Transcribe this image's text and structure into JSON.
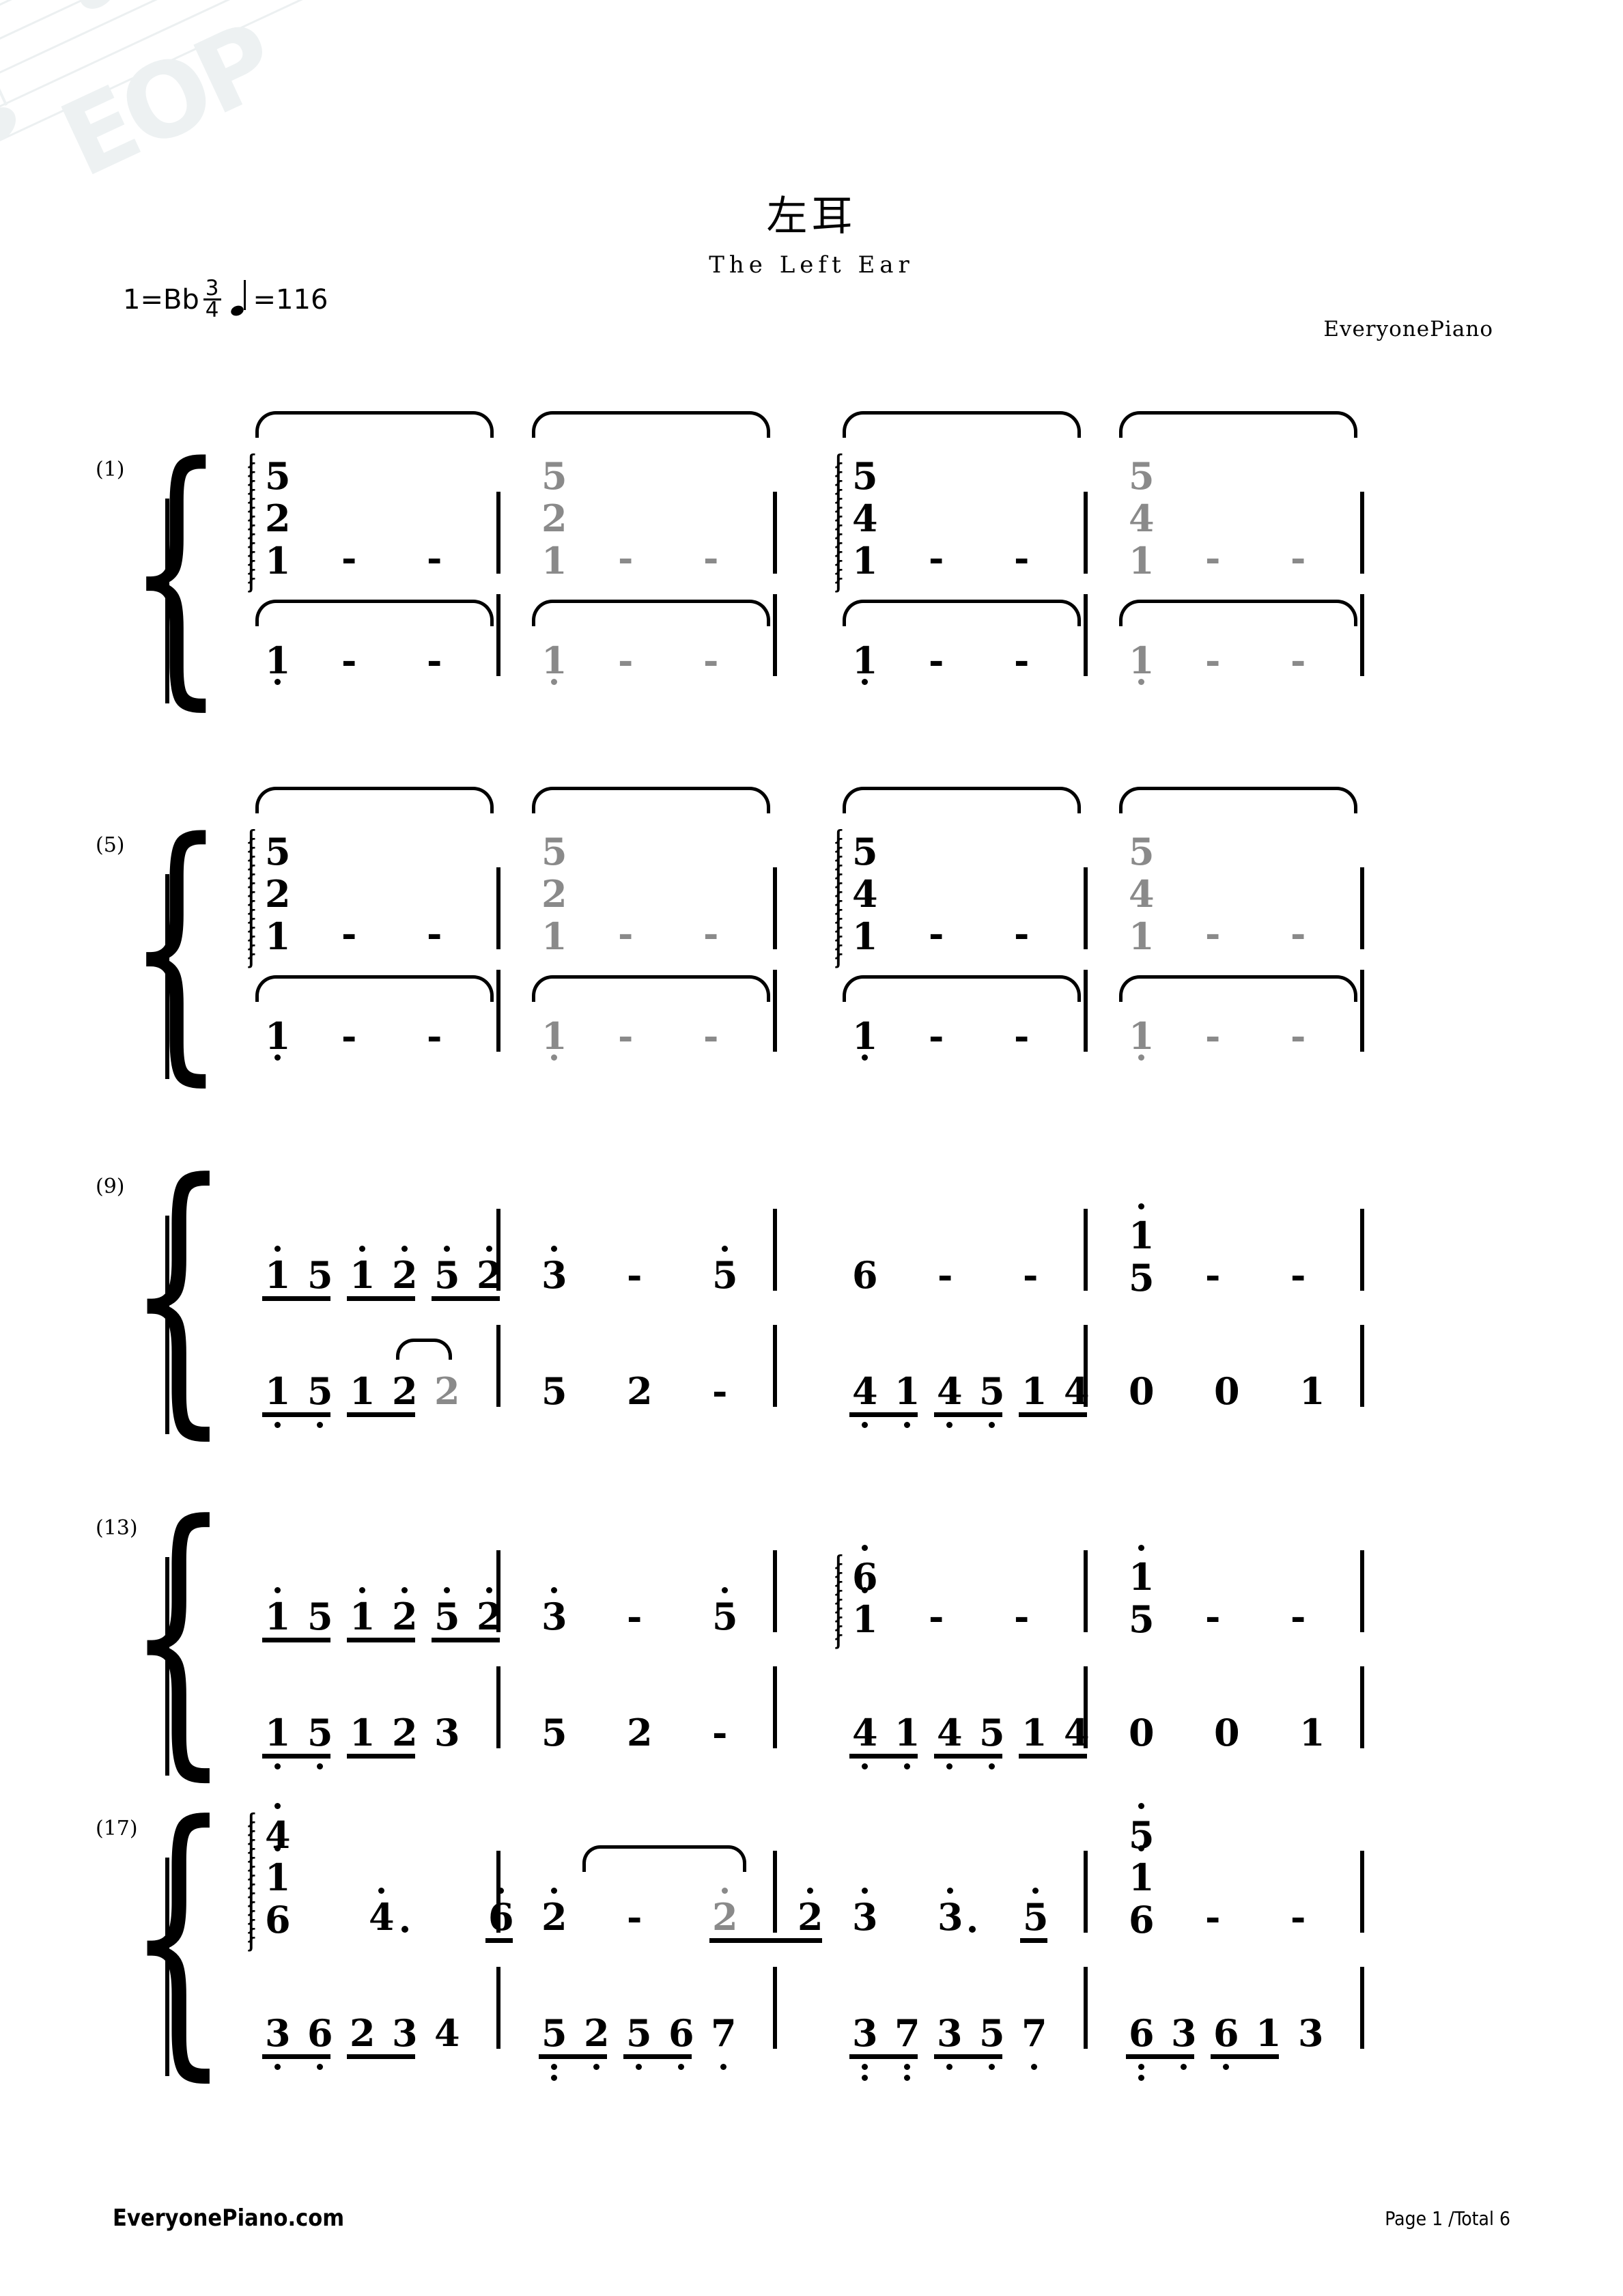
{
  "meta": {
    "title_cn": "左耳",
    "title_en": "The Left Ear",
    "key_label": "1=Bb",
    "time_num": "3",
    "time_den": "4",
    "tempo_eq": "=116",
    "credit": "EveryonePiano",
    "watermark": "EOP",
    "footer_left": "EveryonePiano.com",
    "footer_right": "Page 1 /Total 6",
    "colors": {
      "ink": "#000000",
      "tied_gray": "#8a8a8a",
      "watermark": "#dfe6e8"
    }
  },
  "score": {
    "notation": "jianpu",
    "systems": [
      {
        "number": "(1)",
        "measures": [
          "1",
          "2",
          "3",
          "4"
        ],
        "upper": [
          {
            "measure": "1",
            "chord": [
              "5",
              "2",
              "1"
            ],
            "arpeggio": true,
            "color": "ink",
            "then": [
              "-",
              "-"
            ]
          },
          {
            "measure": "2",
            "chord": [
              "5",
              "2",
              "1"
            ],
            "arpeggio": false,
            "color": "tied_gray",
            "then": [
              "-",
              "-"
            ]
          },
          {
            "measure": "3",
            "chord": [
              "5",
              "4",
              "1"
            ],
            "arpeggio": true,
            "color": "ink",
            "then": [
              "-",
              "-"
            ]
          },
          {
            "measure": "4",
            "chord": [
              "5",
              "4",
              "1"
            ],
            "arpeggio": false,
            "color": "tied_gray",
            "then": [
              "-",
              "-"
            ]
          }
        ],
        "lower": [
          {
            "measure": "1",
            "note": "1",
            "octave": -1,
            "color": "ink",
            "then": [
              "-",
              "-"
            ]
          },
          {
            "measure": "2",
            "note": "1",
            "octave": -1,
            "color": "tied_gray",
            "then": [
              "-",
              "-"
            ]
          },
          {
            "measure": "3",
            "note": "1",
            "octave": -1,
            "color": "ink",
            "then": [
              "-",
              "-"
            ]
          },
          {
            "measure": "4",
            "note": "1",
            "octave": -1,
            "color": "tied_gray",
            "then": [
              "-",
              "-"
            ]
          }
        ]
      },
      {
        "number": "(5)",
        "measures": [
          "5",
          "6",
          "7",
          "8"
        ],
        "upper": [
          {
            "measure": "5",
            "chord": [
              "5",
              "2",
              "1"
            ],
            "arpeggio": true,
            "color": "ink",
            "then": [
              "-",
              "-"
            ]
          },
          {
            "measure": "6",
            "chord": [
              "5",
              "2",
              "1"
            ],
            "arpeggio": false,
            "color": "tied_gray",
            "then": [
              "-",
              "-"
            ]
          },
          {
            "measure": "7",
            "chord": [
              "5",
              "4",
              "1"
            ],
            "arpeggio": true,
            "color": "ink",
            "then": [
              "-",
              "-"
            ]
          },
          {
            "measure": "8",
            "chord": [
              "5",
              "4",
              "1"
            ],
            "arpeggio": false,
            "color": "tied_gray",
            "then": [
              "-",
              "-"
            ]
          }
        ],
        "lower": [
          {
            "measure": "5",
            "note": "1",
            "octave": -1,
            "color": "ink",
            "then": [
              "-",
              "-"
            ]
          },
          {
            "measure": "6",
            "note": "1",
            "octave": -1,
            "color": "tied_gray",
            "then": [
              "-",
              "-"
            ]
          },
          {
            "measure": "7",
            "note": "1",
            "octave": -1,
            "color": "ink",
            "then": [
              "-",
              "-"
            ]
          },
          {
            "measure": "8",
            "note": "1",
            "octave": -1,
            "color": "tied_gray",
            "then": [
              "-",
              "-"
            ]
          }
        ]
      },
      {
        "number": "(9)",
        "measures": [
          "9",
          "10",
          "11",
          "12"
        ],
        "upper": [
          {
            "measure": "9",
            "beams": [
              [
                "1",
                "5"
              ],
              [
                "1",
                "2"
              ],
              [
                "5",
                "2"
              ]
            ],
            "octaves": [
              [
                1,
                0
              ],
              [
                1,
                1
              ],
              [
                1,
                1
              ]
            ]
          },
          {
            "measure": "10",
            "notes": [
              "3",
              "-",
              "5"
            ],
            "octaves": [
              1,
              0,
              1
            ]
          },
          {
            "measure": "11",
            "notes": [
              "6",
              "-",
              "-"
            ],
            "octaves": [
              0,
              0,
              0
            ]
          },
          {
            "measure": "12",
            "chord": [
              "1",
              "5"
            ],
            "chord_octaves": [
              1,
              0
            ],
            "then": [
              "-",
              "-"
            ]
          }
        ],
        "lower": [
          {
            "measure": "9",
            "beams": [
              [
                "1",
                "5"
              ],
              [
                "1",
                "2"
              ]
            ],
            "octaves": [
              [
                -1,
                -1
              ],
              [
                0,
                0
              ]
            ],
            "trail": {
              "note": "2",
              "color": "tied_gray",
              "tie": true
            }
          },
          {
            "measure": "10",
            "notes": [
              "5",
              "2",
              "-"
            ],
            "octaves": [
              0,
              0,
              0
            ]
          },
          {
            "measure": "11",
            "beams": [
              [
                "4",
                "1"
              ],
              [
                "4",
                "5"
              ],
              [
                "1",
                "4"
              ]
            ],
            "octaves": [
              [
                -1,
                -1
              ],
              [
                -1,
                -1
              ],
              [
                0,
                0
              ]
            ]
          },
          {
            "measure": "12",
            "notes": [
              "0",
              "0",
              "1"
            ],
            "octaves": [
              0,
              0,
              0
            ]
          }
        ]
      },
      {
        "number": "(13)",
        "measures": [
          "13",
          "14",
          "15",
          "16"
        ],
        "upper": [
          {
            "measure": "13",
            "beams": [
              [
                "1",
                "5"
              ],
              [
                "1",
                "2"
              ],
              [
                "5",
                "2"
              ]
            ],
            "octaves": [
              [
                1,
                0
              ],
              [
                1,
                1
              ],
              [
                1,
                1
              ]
            ]
          },
          {
            "measure": "14",
            "notes": [
              "3",
              "-",
              "5"
            ],
            "octaves": [
              1,
              0,
              1
            ]
          },
          {
            "measure": "15",
            "chord": [
              "6",
              "1"
            ],
            "chord_octaves": [
              1,
              1
            ],
            "arpeggio": true,
            "then": [
              "-",
              "-"
            ]
          },
          {
            "measure": "16",
            "chord": [
              "1",
              "5"
            ],
            "chord_octaves": [
              1,
              0
            ],
            "then": [
              "-",
              "-"
            ]
          }
        ],
        "lower": [
          {
            "measure": "13",
            "beams": [
              [
                "1",
                "5"
              ],
              [
                "1",
                "2"
              ]
            ],
            "octaves": [
              [
                -1,
                -1
              ],
              [
                0,
                0
              ]
            ],
            "trail": {
              "note": "3",
              "color": "ink",
              "tie": false
            }
          },
          {
            "measure": "14",
            "notes": [
              "5",
              "2",
              "-"
            ],
            "octaves": [
              0,
              0,
              0
            ]
          },
          {
            "measure": "15",
            "beams": [
              [
                "4",
                "1"
              ],
              [
                "4",
                "5"
              ],
              [
                "1",
                "4"
              ]
            ],
            "octaves": [
              [
                -1,
                -1
              ],
              [
                -1,
                -1
              ],
              [
                0,
                0
              ]
            ]
          },
          {
            "measure": "16",
            "notes": [
              "0",
              "0",
              "1"
            ],
            "octaves": [
              0,
              0,
              0
            ]
          }
        ]
      },
      {
        "number": "(17)",
        "measures": [
          "17",
          "18",
          "19",
          "20"
        ],
        "upper": [
          {
            "measure": "17",
            "chord": [
              "4",
              "1",
              "6"
            ],
            "chord_octaves": [
              1,
              1,
              0
            ],
            "arpeggio": true,
            "then_notes": [
              "4",
              "6"
            ],
            "then_octaves": [
              1,
              1
            ],
            "dotted": [
              true,
              false
            ],
            "half_beam_last": true
          },
          {
            "measure": "18",
            "notes": [
              "2",
              "-",
              "2",
              "2"
            ],
            "octaves": [
              1,
              0,
              1,
              1
            ],
            "gray_index": 2,
            "beam_last_pair": true,
            "slur": true
          },
          {
            "measure": "19",
            "notes": [
              "3",
              "3",
              "5"
            ],
            "octaves": [
              1,
              1,
              1
            ],
            "dotted": [
              false,
              true,
              false
            ],
            "half_beam_last": true
          },
          {
            "measure": "20",
            "chord": [
              "5",
              "1",
              "6"
            ],
            "chord_octaves": [
              1,
              1,
              0
            ],
            "then": [
              "-",
              "-"
            ]
          }
        ],
        "lower": [
          {
            "measure": "17",
            "beams": [
              [
                "3",
                "6"
              ],
              [
                "2",
                "3"
              ]
            ],
            "octaves": [
              [
                -1,
                -1
              ],
              [
                0,
                0
              ]
            ],
            "trail": {
              "note": "4",
              "color": "ink",
              "tie": false
            }
          },
          {
            "measure": "18",
            "beams": [
              [
                "5",
                "2"
              ],
              [
                "5",
                "6"
              ]
            ],
            "octaves": [
              [
                -2,
                -1
              ],
              [
                -1,
                -1
              ]
            ],
            "trail": {
              "note": "7",
              "color": "ink",
              "octave": -1
            }
          },
          {
            "measure": "19",
            "beams": [
              [
                "3",
                "7"
              ],
              [
                "3",
                "5"
              ]
            ],
            "octaves": [
              [
                -2,
                -2
              ],
              [
                -1,
                -1
              ]
            ],
            "trail": {
              "note": "7",
              "color": "ink",
              "octave": -1
            }
          },
          {
            "measure": "20",
            "beams": [
              [
                "6",
                "3"
              ],
              [
                "6",
                "1"
              ]
            ],
            "octaves": [
              [
                -2,
                -1
              ],
              [
                -1,
                0
              ]
            ],
            "trail": {
              "note": "3",
              "color": "ink",
              "octave": 0
            }
          }
        ]
      }
    ]
  }
}
